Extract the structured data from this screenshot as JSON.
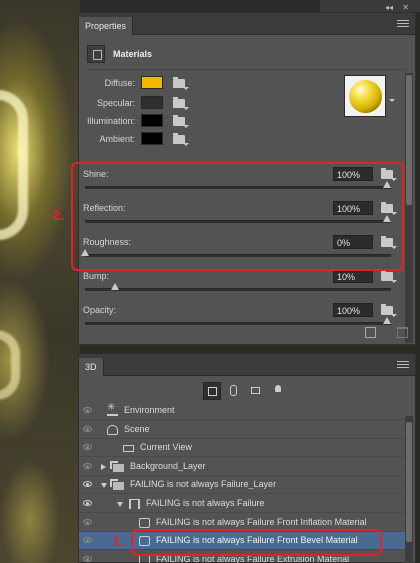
{
  "properties_panel": {
    "tab_label": "Properties",
    "section_title": "Materials",
    "color_rows": [
      {
        "label": "Diffuse:",
        "color": "#f5b800"
      },
      {
        "label": "Specular:",
        "color": "#2f2f2f"
      },
      {
        "label": "Illumination:",
        "color": "#000000"
      },
      {
        "label": "Ambient:",
        "color": "#000000"
      }
    ],
    "sliders": [
      {
        "label": "Shine:",
        "value": "100%",
        "level": 1.0
      },
      {
        "label": "Reflection:",
        "value": "100%",
        "level": 1.0
      },
      {
        "label": "Roughness:",
        "value": "0%",
        "level": 0.0
      },
      {
        "label": "Bump:",
        "value": "10%",
        "level": 0.1
      },
      {
        "label": "Opacity:",
        "value": "100%",
        "level": 1.0
      }
    ]
  },
  "threeD_panel": {
    "tab_label": "3D",
    "tree": [
      {
        "label": "Environment",
        "icon": "environment-icon",
        "twist": "none"
      },
      {
        "label": "Scene",
        "icon": "scene-icon",
        "twist": "none"
      },
      {
        "label": "Current View",
        "icon": "camera-icon",
        "twist": "none"
      },
      {
        "label": "Background_Layer",
        "icon": "layer-icon",
        "twist": "closed"
      },
      {
        "label": "FAILING is not always Failure_Layer",
        "icon": "layer-icon",
        "twist": "open"
      },
      {
        "label": "FAILING is not always Failure",
        "icon": "mesh-icon",
        "twist": "open"
      },
      {
        "label": "FAILING is not always Failure Front Inflation Material",
        "icon": "material-icon",
        "twist": "none"
      },
      {
        "label": "FAILING is not always Failure Front Bevel Material",
        "icon": "material-icon",
        "twist": "none",
        "selected": true
      },
      {
        "label": "FAILING is not always Failure Extrusion Material",
        "icon": "material-icon",
        "twist": "none"
      }
    ]
  },
  "annotations": {
    "label_1": "1.",
    "label_2": "2.",
    "color": "#e5202a"
  },
  "colors": {
    "panel_bg": "#535353",
    "selection": "#4a6b90",
    "accent_red": "#e5202a"
  }
}
